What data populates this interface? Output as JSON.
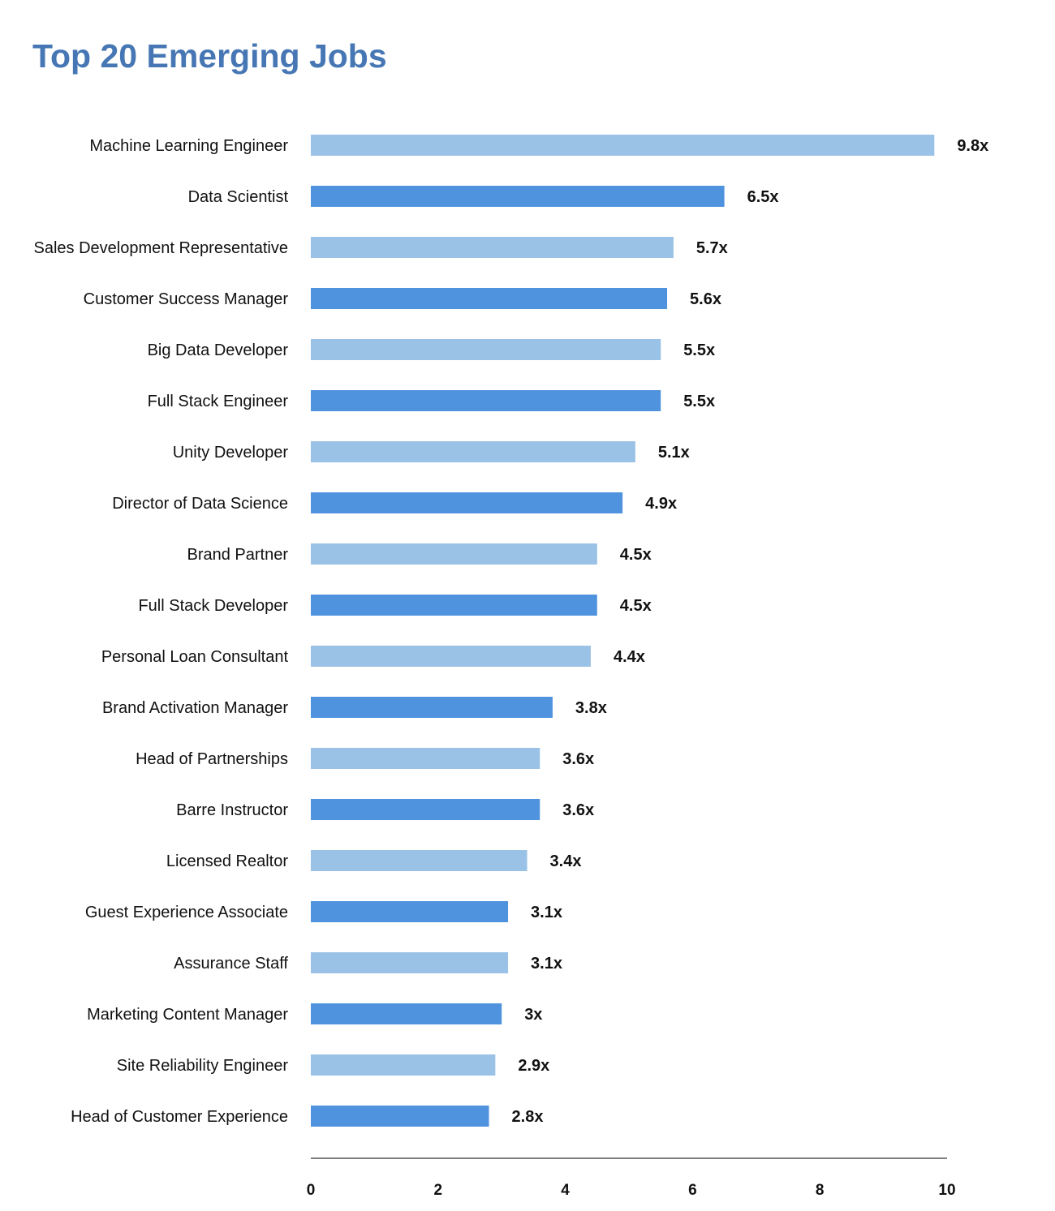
{
  "chart_data": {
    "type": "bar",
    "orientation": "horizontal",
    "title": "Top 20 Emerging Jobs",
    "xlabel": "",
    "ylabel": "",
    "xlim": [
      0,
      10
    ],
    "x_ticks": [
      "0",
      "2",
      "4",
      "6",
      "8",
      "10"
    ],
    "grid": false,
    "legend": null,
    "colors": [
      "#9ac1e6",
      "#4f93df"
    ],
    "categories": [
      "Machine Learning Engineer",
      "Data Scientist",
      "Sales Development Representative",
      "Customer Success Manager",
      "Big Data Developer",
      "Full Stack Engineer",
      "Unity Developer",
      "Director of Data Science",
      "Brand Partner",
      "Full Stack Developer",
      "Personal Loan Consultant",
      "Brand Activation Manager",
      "Head of Partnerships",
      "Barre Instructor",
      "Licensed Realtor",
      "Guest Experience Associate",
      "Assurance Staff",
      "Marketing Content Manager",
      "Site Reliability Engineer",
      "Head of Customer Experience"
    ],
    "values": [
      9.8,
      6.5,
      5.7,
      5.6,
      5.5,
      5.5,
      5.1,
      4.9,
      4.5,
      4.5,
      4.4,
      3.8,
      3.6,
      3.6,
      3.4,
      3.1,
      3.1,
      3,
      2.9,
      2.8
    ],
    "value_labels": [
      "9.8x",
      "6.5x",
      "5.7x",
      "5.6x",
      "5.5x",
      "5.5x",
      "5.1x",
      "4.9x",
      "4.5x",
      "4.5x",
      "4.4x",
      "3.8x",
      "3.6x",
      "3.6x",
      "3.4x",
      "3.1x",
      "3.1x",
      "3x",
      "2.9x",
      "2.8x"
    ]
  }
}
